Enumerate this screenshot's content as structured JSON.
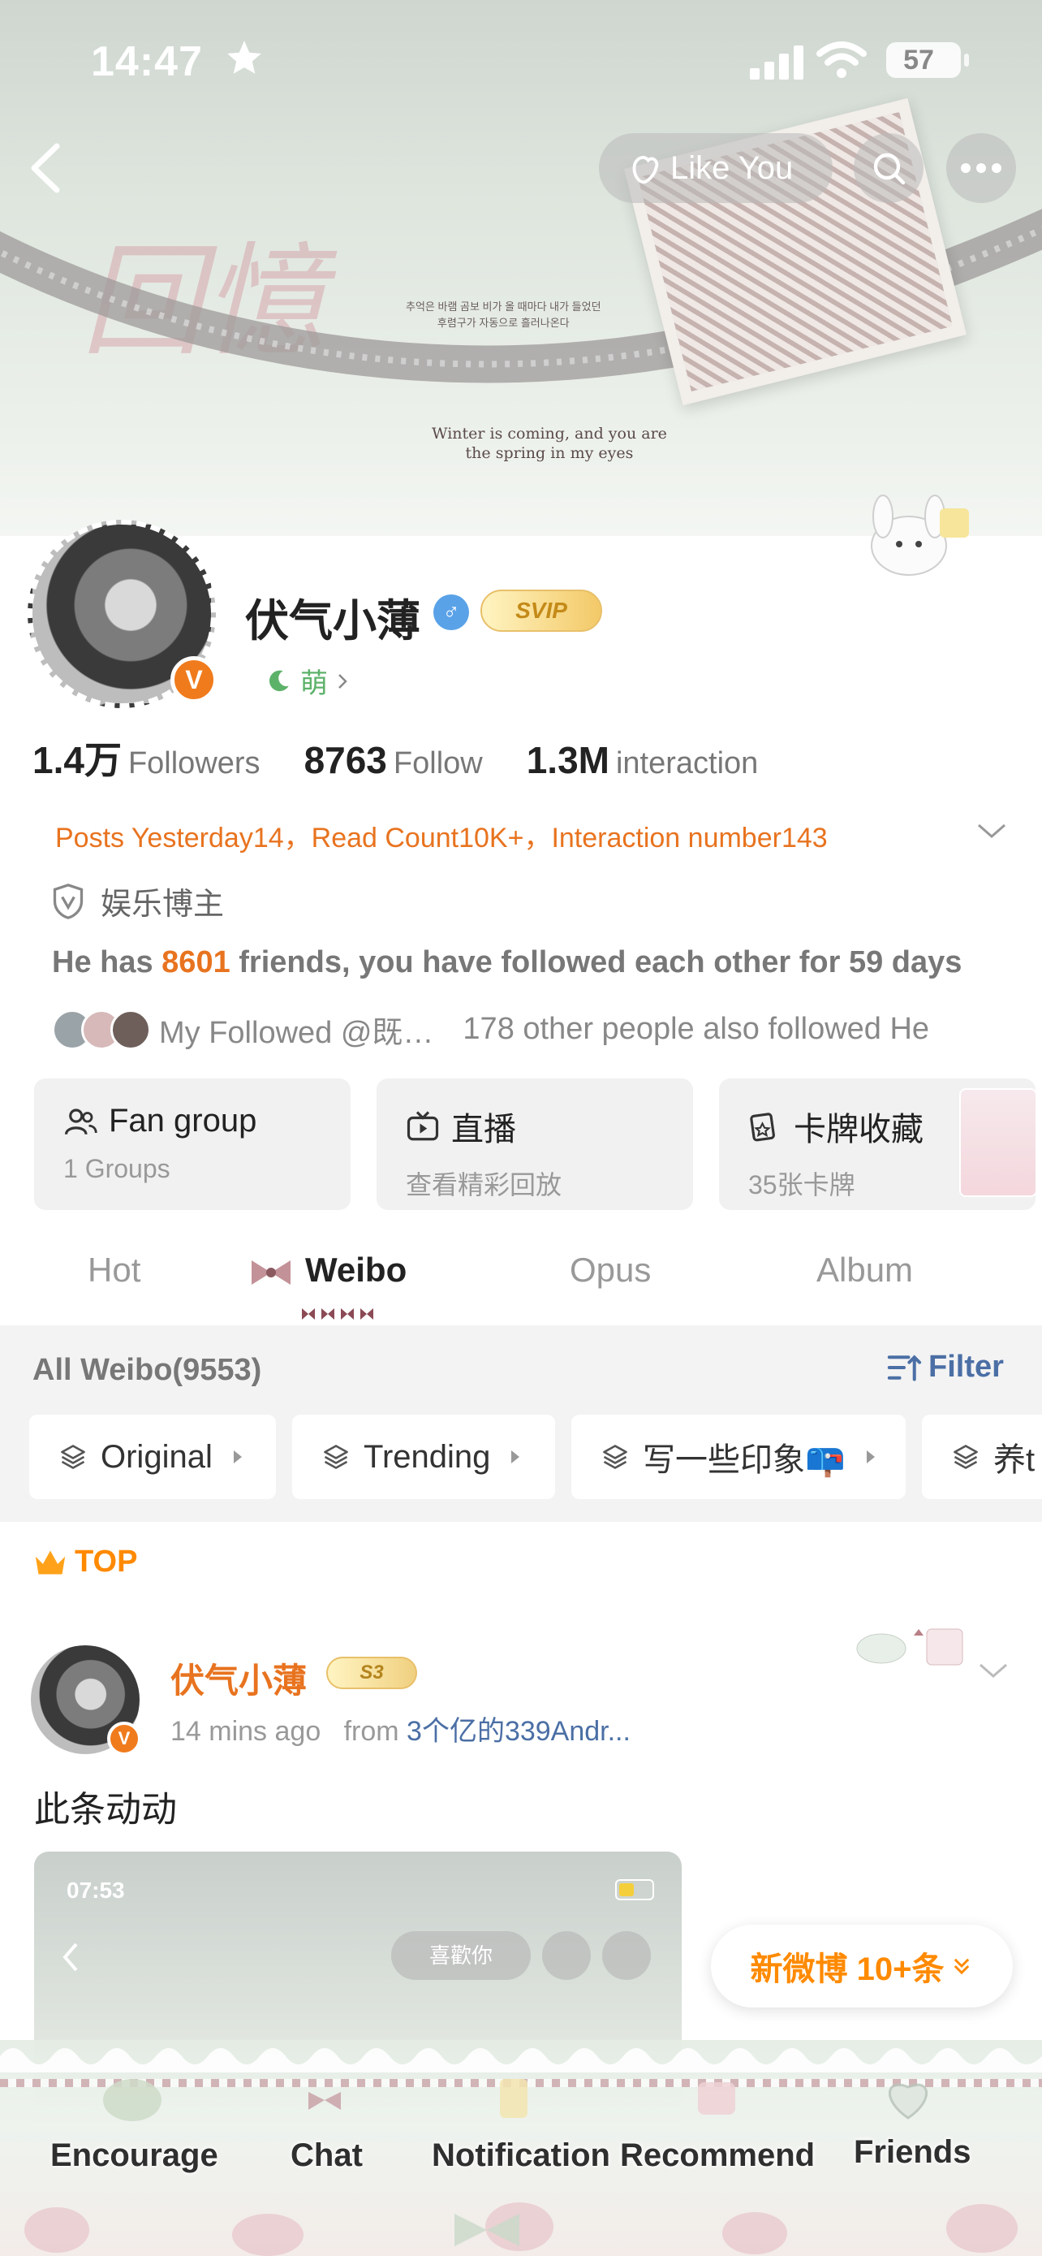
{
  "status_bar": {
    "time": "14:47",
    "battery": "57"
  },
  "banner": {
    "korean_text_line1": "추억은 바램 곰보 비가 올 때마다 내가 들었던",
    "korean_text_line2": "후렴구가 자동으로 흘러나온다",
    "caption_line1": "Winter is coming, and you are",
    "caption_line2": "the spring in my eyes"
  },
  "nav": {
    "like_label": "Like You"
  },
  "profile": {
    "name": "伏气小薄",
    "gender_symbol": "♂",
    "vip_badge": "SVIP",
    "moe_tag": "萌",
    "verified_mark": "V",
    "stats": [
      {
        "num": "1.4万",
        "label": "Followers"
      },
      {
        "num": "8763",
        "label": "Follow"
      },
      {
        "num": "1.3M",
        "label": "interaction"
      }
    ],
    "posts_line": "Posts Yesterday14，Read Count10K+，Interaction number143",
    "category_tag": "娱乐博主",
    "friends_prefix": "He has ",
    "friends_count": "8601",
    "friends_suffix": " friends, you have followed each other for 59 days",
    "mutual_followed": "My Followed @既…",
    "mutual_others": "178 other people also followed He"
  },
  "cards": [
    {
      "title": "Fan group",
      "sub": "1 Groups"
    },
    {
      "title": "直播",
      "sub": "查看精彩回放"
    },
    {
      "title": "卡牌收藏",
      "sub": "35张卡牌"
    }
  ],
  "tabs": [
    {
      "label": "Hot",
      "active": false
    },
    {
      "label": "Weibo",
      "active": true
    },
    {
      "label": "Opus",
      "active": false
    },
    {
      "label": "Album",
      "active": false
    }
  ],
  "list": {
    "all_weibo": "All Weibo(9553)",
    "filter": "Filter",
    "chips": [
      "Original",
      "Trending",
      "写一些印象📪",
      "养t"
    ]
  },
  "pinned_post": {
    "top_label": "TOP",
    "name": "伏气小薄",
    "level": "S3",
    "time": "14 mins ago",
    "from_prefix": "from ",
    "source": "3个亿的339Andr...",
    "text": "此条动动",
    "shot_time": "07:53",
    "shot_like": "喜歡你"
  },
  "new_posts": "新微博 10+条",
  "bottom_tabs": [
    "Encourage",
    "Chat",
    "Notification",
    "Recommend",
    "Friends"
  ],
  "colors": {
    "accent_orange": "#e8731f",
    "link_blue": "#4b6fa5",
    "gender_blue": "#5aa2e8",
    "top_orange": "#ff8a00"
  }
}
